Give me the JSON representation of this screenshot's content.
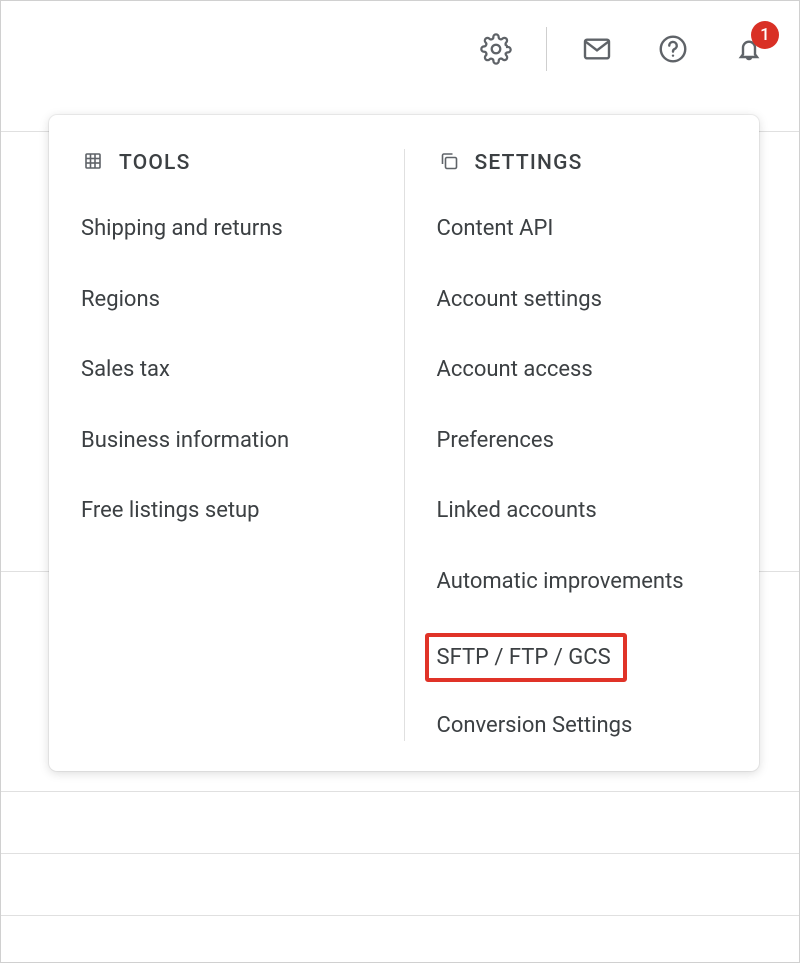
{
  "toolbar": {
    "notification_count": "1"
  },
  "dropdown": {
    "tools": {
      "title": "TOOLS",
      "items": [
        "Shipping and returns",
        "Regions",
        "Sales tax",
        "Business information",
        "Free listings setup"
      ]
    },
    "settings": {
      "title": "SETTINGS",
      "items": [
        "Content API",
        "Account settings",
        "Account access",
        "Preferences",
        "Linked accounts",
        "Automatic improvements",
        "SFTP / FTP / GCS",
        "Conversion Settings"
      ]
    }
  }
}
